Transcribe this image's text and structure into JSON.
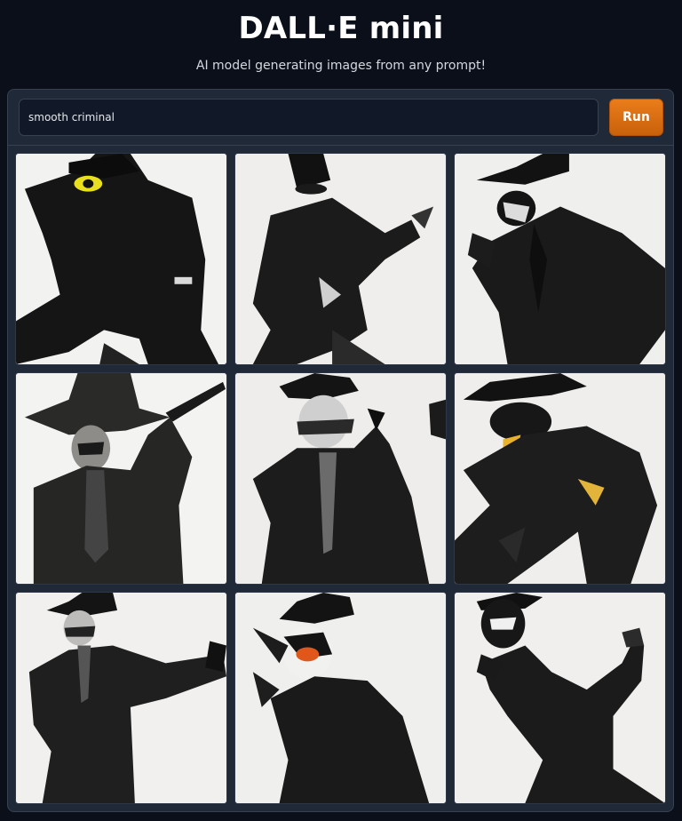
{
  "header": {
    "title": "DALL·E mini",
    "subtitle": "AI model generating images from any prompt!"
  },
  "prompt": {
    "value": "smooth criminal",
    "run_label": "Run"
  },
  "gallery": {
    "count": 9
  }
}
